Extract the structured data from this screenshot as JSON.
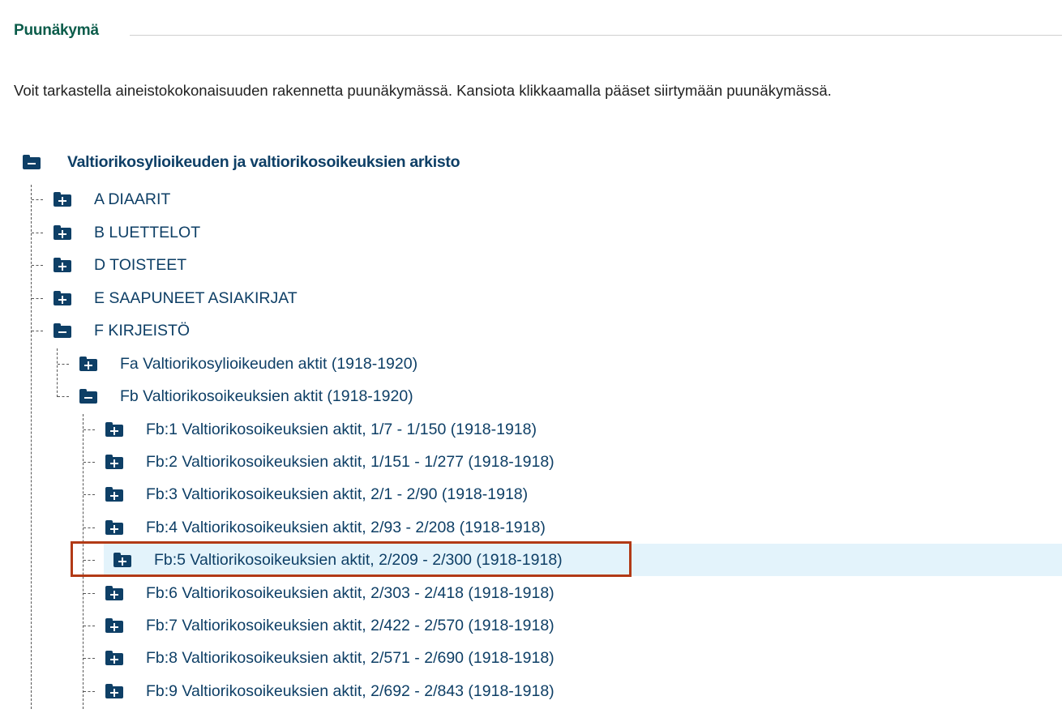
{
  "section": {
    "title": "Puunäkymä",
    "description": "Voit tarkastella aineistokokonaisuuden rakennetta puunäkymässä. Kansiota klikkaamalla pääset siirtymään puunäkymässä."
  },
  "colors": {
    "title_green": "#0b5c4a",
    "link_blue": "#0e3f66",
    "highlight_bg": "#e3f3fb",
    "selection_border": "#b23a16"
  },
  "icons": {
    "expanded": "folder-minus-icon",
    "collapsed": "folder-plus-icon"
  },
  "tree": {
    "root": {
      "label": "Valtiorikosylioikeuden ja valtiorikosoikeuksien arkisto",
      "expanded": true
    },
    "level1": [
      {
        "label": "A DIAARIT",
        "expanded": false
      },
      {
        "label": "B LUETTELOT",
        "expanded": false
      },
      {
        "label": "D TOISTEET",
        "expanded": false
      },
      {
        "label": "E SAAPUNEET ASIAKIRJAT",
        "expanded": false
      },
      {
        "label": "F KIRJEISTÖ",
        "expanded": true
      }
    ],
    "level2": [
      {
        "label": "Fa Valtiorikosylioikeuden aktit (1918-1920)",
        "expanded": false
      },
      {
        "label": "Fb Valtiorikosoikeuksien aktit (1918-1920)",
        "expanded": true
      }
    ],
    "level3": [
      {
        "label": "Fb:1 Valtiorikosoikeuksien aktit, 1/7 - 1/150 (1918-1918)",
        "expanded": false
      },
      {
        "label": "Fb:2 Valtiorikosoikeuksien aktit, 1/151 - 1/277 (1918-1918)",
        "expanded": false
      },
      {
        "label": "Fb:3 Valtiorikosoikeuksien aktit, 2/1 - 2/90 (1918-1918)",
        "expanded": false
      },
      {
        "label": "Fb:4 Valtiorikosoikeuksien aktit, 2/93 - 2/208 (1918-1918)",
        "expanded": false
      },
      {
        "label": "Fb:5 Valtiorikosoikeuksien aktit, 2/209 - 2/300 (1918-1918)",
        "expanded": false,
        "selected": true
      },
      {
        "label": "Fb:6 Valtiorikosoikeuksien aktit, 2/303 - 2/418 (1918-1918)",
        "expanded": false
      },
      {
        "label": "Fb:7 Valtiorikosoikeuksien aktit, 2/422 - 2/570 (1918-1918)",
        "expanded": false
      },
      {
        "label": "Fb:8 Valtiorikosoikeuksien aktit, 2/571 - 2/690 (1918-1918)",
        "expanded": false
      },
      {
        "label": "Fb:9 Valtiorikosoikeuksien aktit, 2/692 - 2/843 (1918-1918)",
        "expanded": false
      }
    ]
  }
}
